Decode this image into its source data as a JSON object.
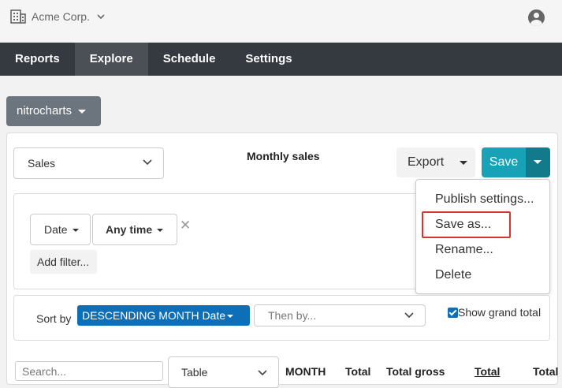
{
  "header": {
    "org_name": "Acme Corp.",
    "org_icon": "building-icon",
    "user_icon": "user-circle-icon"
  },
  "nav": {
    "tabs": [
      {
        "label": "Reports",
        "active": false
      },
      {
        "label": "Explore",
        "active": true
      },
      {
        "label": "Schedule",
        "active": false
      },
      {
        "label": "Settings",
        "active": false
      }
    ]
  },
  "datasource": {
    "label": "nitrocharts"
  },
  "report": {
    "source_select": "Sales",
    "title": "Monthly sales",
    "export_label": "Export",
    "save_label": "Save"
  },
  "save_menu": {
    "items": [
      "Publish settings...",
      "Save as...",
      "Rename...",
      "Delete"
    ],
    "highlighted": "Save as..."
  },
  "filters": {
    "date_label": "Date",
    "range_label": "Any time",
    "add_filter_label": "Add filter..."
  },
  "sort": {
    "label": "Sort by",
    "primary": "DESCENDING MONTH Date",
    "secondary_placeholder": "Then by...",
    "grand_total_label": "Show grand total",
    "grand_total_checked": true
  },
  "table": {
    "search_placeholder": "Search...",
    "view_select": "Table",
    "columns": [
      "MONTH",
      "Total",
      "Total gross",
      "Total",
      "Total"
    ]
  },
  "colors": {
    "nav_bg": "#343a40",
    "save_accent": "#17a2b8",
    "sort_pill": "#0d6fb8",
    "highlight": "#d9332b"
  }
}
